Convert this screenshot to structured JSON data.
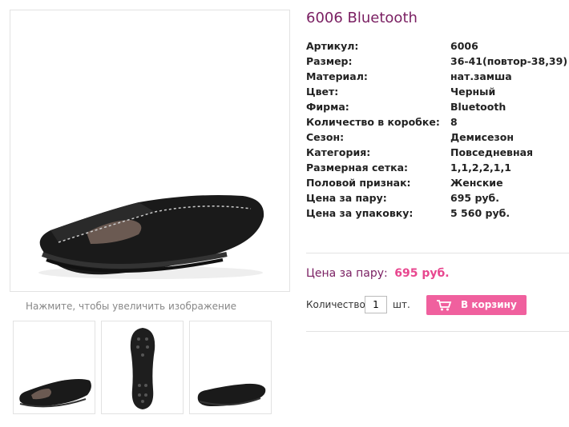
{
  "product": {
    "title": "6006 Bluetooth",
    "zoom_hint": "Нажмите, чтобы увеличить изображение"
  },
  "specs": [
    {
      "label": "Артикул:",
      "value": "6006"
    },
    {
      "label": "Размер:",
      "value": "36-41(повтор-38,39)"
    },
    {
      "label": "Материал:",
      "value": "нат.замша"
    },
    {
      "label": "Цвет:",
      "value": "Черный"
    },
    {
      "label": "Фирма:",
      "value": "Bluetooth"
    },
    {
      "label": "Количество в коробке:",
      "value": "8"
    },
    {
      "label": "Сезон:",
      "value": "Демисезон"
    },
    {
      "label": "Категория:",
      "value": "Повседневная"
    },
    {
      "label": "Размерная сетка:",
      "value": "1,1,2,2,1,1"
    },
    {
      "label": "Половой признак:",
      "value": "Женские"
    },
    {
      "label": "Цена за пару:",
      "value": "695 руб."
    },
    {
      "label": "Цена за упаковку:",
      "value": "5 560 руб."
    }
  ],
  "purchase": {
    "price_label": "Цена за пару:",
    "price_value": "695 руб.",
    "qty_label": "Количество",
    "qty_value": "1",
    "qty_unit": "шт.",
    "cart_button": "В корзину"
  },
  "thumbnails": [
    "side-view",
    "sole-view",
    "rear-view"
  ],
  "colors": {
    "title": "#7a1f62",
    "price": "#e8478f",
    "button": "#f0609e"
  }
}
